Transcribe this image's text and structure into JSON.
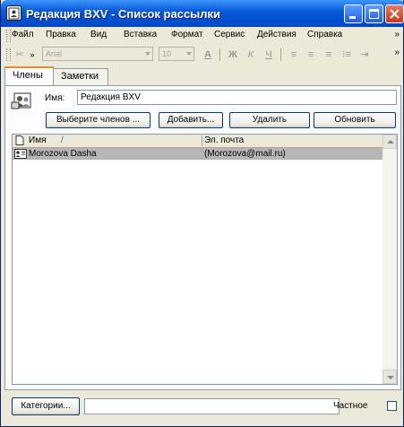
{
  "window": {
    "title": "Редакция BXV - Список рассылки",
    "icon": "address-book-icon",
    "controls": [
      "minimize-icon",
      "maximize-icon",
      "close-icon"
    ]
  },
  "menu": [
    "Файл",
    "Правка",
    "Вид",
    "Вставка",
    "Формат",
    "Сервис",
    "Действия",
    "Справка"
  ],
  "format_toolbar": {
    "font_name": "Arial",
    "font_size": "10",
    "tools": [
      "cut-icon",
      "font-color-icon",
      "bold-icon",
      "italic-icon",
      "underline-icon",
      "align-left-icon",
      "align-center-icon",
      "align-right-icon",
      "bullets-icon",
      "indent-icon"
    ],
    "overflow_label": "»"
  },
  "tabs": [
    {
      "label": "Члены",
      "active": true
    },
    {
      "label": "Заметки",
      "active": false
    }
  ],
  "members": {
    "name_label": "Имя:",
    "name_value": "Редакция BXV",
    "buttons": {
      "select_members": "Выберите членов ...",
      "add_new": "Добавить...",
      "remove": "Удалить",
      "update": "Обновить"
    },
    "columns": [
      "Имя",
      "Эл. почта"
    ],
    "sort_indicator": "/",
    "rows": [
      {
        "name": "Morozova Dasha",
        "email": "(Morozova@mail.ru)"
      }
    ]
  },
  "footer": {
    "categories_button": "Категории...",
    "categories_value": "",
    "private_label": "Частное",
    "private_checked": false
  },
  "colors": {
    "titlebar": "#0a5bd8",
    "face": "#ece9d8",
    "selected_row": "#b6b6b6",
    "active_tab_accent": "#e68b2c"
  }
}
